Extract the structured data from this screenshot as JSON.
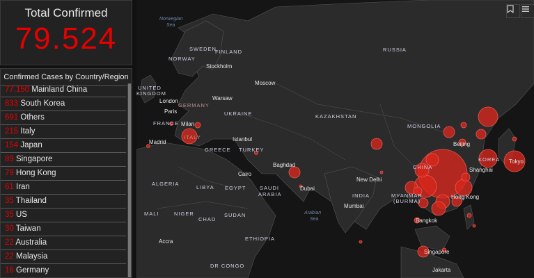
{
  "total": {
    "title": "Total Confirmed",
    "value": "79.524"
  },
  "list": {
    "header": "Confirmed Cases by Country/Region",
    "rows": [
      {
        "count": "77.150",
        "name": "Mainland China"
      },
      {
        "count": "833",
        "name": "South Korea"
      },
      {
        "count": "691",
        "name": "Others"
      },
      {
        "count": "215",
        "name": "Italy"
      },
      {
        "count": "154",
        "name": "Japan"
      },
      {
        "count": "89",
        "name": "Singapore"
      },
      {
        "count": "79",
        "name": "Hong Kong"
      },
      {
        "count": "61",
        "name": "Iran"
      },
      {
        "count": "35",
        "name": "Thailand"
      },
      {
        "count": "35",
        "name": "US"
      },
      {
        "count": "30",
        "name": "Taiwan"
      },
      {
        "count": "22",
        "name": "Australia"
      },
      {
        "count": "22",
        "name": "Malaysia"
      },
      {
        "count": "16",
        "name": "Germany"
      }
    ]
  },
  "map": {
    "labels": {
      "norwegian_sea_1": "Norwegian",
      "norwegian_sea_2": "Sea",
      "sweden": "SWEDEN",
      "finland": "FINLAND",
      "norway": "NORWAY",
      "stockholm": "Stockholm",
      "russia": "RUSSIA",
      "united": "UNITED",
      "kingdom": "KINGDOM",
      "london": "London",
      "germany": "GERMANY",
      "warsaw": "Warsaw",
      "moscow": "Moscow",
      "paris": "Paris",
      "ukraine": "UKRAINE",
      "france": "FRANCE",
      "milan": "Milan",
      "kazakhstan": "KAZAKHSTAN",
      "mongolia": "MONGOLIA",
      "madrid": "Madrid",
      "italy": "ITALY",
      "istanbul": "Istanbul",
      "beijing": "Beijing",
      "greece": "GREECE",
      "turkey": "TURKEY",
      "korea": "KOREA",
      "tokyo": "Tokyo",
      "baghdad": "Baghdad",
      "china": "CHINA",
      "shanghai": "Shanghai",
      "cairo": "Cairo",
      "algeria": "ALGERIA",
      "libya": "LIBYA",
      "egypt": "EGYPT",
      "saudi": "SAUDI",
      "arabia": "ARABIA",
      "dubai": "Dubai",
      "new_delhi": "New Delhi",
      "india": "INDIA",
      "myanmar": "MYANMAR",
      "burma": "(BURMA)",
      "hong_kong": "Hong Kong",
      "mumbai": "Mumbai",
      "mali": "MALI",
      "niger": "NIGER",
      "chad": "CHAD",
      "sudan": "SUDAN",
      "arabian_sea_1": "Arabian",
      "arabian_sea_2": "Sea",
      "bangkok": "Bangkok",
      "accra": "Accra",
      "ethiopia": "ETHIOPIA",
      "singapore": "Singapore",
      "dr_congo": "DR CONGO",
      "jakarta": "Jakarta"
    }
  },
  "colors": {
    "accent": "#e60000",
    "bubble": "#d8261c"
  }
}
